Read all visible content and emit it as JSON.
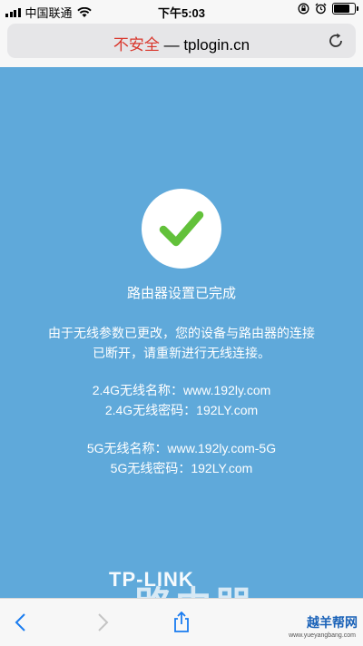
{
  "status_bar": {
    "carrier": "中国联通",
    "time": "下午5:03"
  },
  "url_bar": {
    "security_label": "不安全",
    "separator": " — ",
    "domain": "tplogin.cn"
  },
  "main": {
    "title": "路由器设置已完成",
    "message": "由于无线参数已更改，您的设备与路由器的连接已断开，请重新进行无线连接。",
    "wifi_24_name": "2.4G无线名称：www.192ly.com",
    "wifi_24_password": "2.4G无线密码：192LY.com",
    "wifi_5_name": "5G无线名称：www.192ly.com-5G",
    "wifi_5_password": "5G无线密码：192LY.com",
    "brand_logo": "TP-LINK"
  },
  "watermark": {
    "text_large": "路由器",
    "site_name": "越羊帮网",
    "site_url": "www.yueyangbang.com"
  },
  "colors": {
    "page_background": "#5fa9da",
    "check_green": "#62c13a",
    "insecure_red": "#d9362b"
  },
  "icons": [
    "wifi-icon",
    "reload-icon",
    "checkmark-icon",
    "back-icon",
    "forward-icon",
    "share-icon",
    "lock-rotation-icon",
    "alarm-icon",
    "battery-icon"
  ]
}
